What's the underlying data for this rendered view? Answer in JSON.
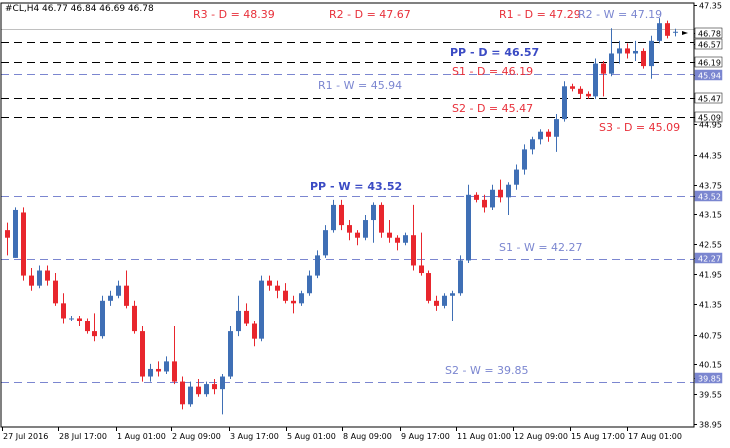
{
  "chart_data": {
    "type": "candlestick",
    "symbol_info": "#CL,H4  46.77 46.84 46.69 46.78",
    "y_axis": {
      "range": [
        38.95,
        47.35
      ],
      "ticks": [
        "47.35",
        "46.78",
        "46.57",
        "46.19",
        "45.94",
        "45.47",
        "45.09",
        "44.95",
        "44.35",
        "43.75",
        "43.52",
        "43.15",
        "42.55",
        "42.27",
        "41.95",
        "41.35",
        "40.75",
        "40.15",
        "39.85",
        "39.55",
        "38.95"
      ],
      "badges": [
        {
          "label": "46.78",
          "value": 46.78,
          "bg": "#ffffff",
          "fg": "#000000"
        },
        {
          "label": "46.57",
          "value": 46.57,
          "bg": "#ffffff",
          "fg": "#000000"
        },
        {
          "label": "46.19",
          "value": 46.19,
          "bg": "#ffffff",
          "fg": "#000000"
        },
        {
          "label": "45.94",
          "value": 45.94,
          "bg": "#7b86d0",
          "fg": "#ffffff"
        },
        {
          "label": "45.47",
          "value": 45.47,
          "bg": "#ffffff",
          "fg": "#000000"
        },
        {
          "label": "45.09",
          "value": 45.09,
          "bg": "#ffffff",
          "fg": "#000000"
        },
        {
          "label": "43.52",
          "value": 43.52,
          "bg": "#7b86d0",
          "fg": "#ffffff"
        },
        {
          "label": "42.27",
          "value": 42.27,
          "bg": "#7b86d0",
          "fg": "#ffffff"
        },
        {
          "label": "39.85",
          "value": 39.85,
          "bg": "#7b86d0",
          "fg": "#ffffff"
        }
      ]
    },
    "x_axis": {
      "tick_labels": [
        "27 Jul 2016",
        "28 Jul 17:00",
        "1 Aug 01:00",
        "2 Aug 09:00",
        "3 Aug 17:00",
        "5 Aug 01:00",
        "8 Aug 09:00",
        "9 Aug 17:00",
        "11 Aug 01:00",
        "12 Aug 09:00",
        "15 Aug 17:00",
        "17 Aug 01:00"
      ]
    },
    "levels": [
      {
        "name": "R3 - D = 48.39",
        "value": 48.39,
        "color": "#e8303a",
        "style": "label-only"
      },
      {
        "name": "R2 - D = 47.67",
        "value": 47.67,
        "color": "#e8303a",
        "style": "label-only"
      },
      {
        "name": "R1 - D = 47.29",
        "value": 47.29,
        "color": "#e8303a",
        "style": "label-only"
      },
      {
        "name": "R2 - W = 47.19",
        "value": 47.19,
        "color": "#7b86d0",
        "style": "label-only"
      },
      {
        "name": "PP - D = 46.57",
        "value": 46.57,
        "color": "#3b4bc4",
        "style": "dashed-black"
      },
      {
        "name": "S1 - D = 46.19",
        "value": 46.19,
        "color": "#e8303a",
        "style": "dashed-black"
      },
      {
        "name": "R1 - W = 45.94",
        "value": 45.94,
        "color": "#7b86d0",
        "style": "dashed-blue"
      },
      {
        "name": "S2 - D = 45.47",
        "value": 45.47,
        "color": "#e8303a",
        "style": "dashed-black"
      },
      {
        "name": "S3 - D = 45.09",
        "value": 45.09,
        "color": "#e8303a",
        "style": "dashed-black"
      },
      {
        "name": "PP - W = 43.52",
        "value": 43.52,
        "color": "#3b4bc4",
        "style": "dashed-blue"
      },
      {
        "name": "S1 - W = 42.27",
        "value": 42.27,
        "color": "#7b86d0",
        "style": "dashed-blue"
      },
      {
        "name": "S2 - W = 39.85",
        "value": 39.85,
        "color": "#7b86d0",
        "style": "dashed-blue"
      }
    ],
    "candles": [
      {
        "o": 42.85,
        "h": 43.0,
        "l": 42.35,
        "c": 42.7
      },
      {
        "o": 42.3,
        "h": 43.3,
        "l": 42.3,
        "c": 43.25
      },
      {
        "o": 43.2,
        "h": 43.3,
        "l": 41.85,
        "c": 41.95
      },
      {
        "o": 41.95,
        "h": 42.1,
        "l": 41.65,
        "c": 41.75
      },
      {
        "o": 41.75,
        "h": 42.15,
        "l": 41.7,
        "c": 42.05
      },
      {
        "o": 42.05,
        "h": 42.15,
        "l": 41.75,
        "c": 41.85
      },
      {
        "o": 41.85,
        "h": 42.0,
        "l": 41.35,
        "c": 41.4
      },
      {
        "o": 41.4,
        "h": 41.6,
        "l": 41.0,
        "c": 41.1
      },
      {
        "o": 41.1,
        "h": 41.15,
        "l": 41.05,
        "c": 41.1
      },
      {
        "o": 41.1,
        "h": 41.15,
        "l": 40.95,
        "c": 41.05
      },
      {
        "o": 41.05,
        "h": 41.1,
        "l": 40.8,
        "c": 40.85
      },
      {
        "o": 40.85,
        "h": 41.2,
        "l": 40.65,
        "c": 40.75
      },
      {
        "o": 40.75,
        "h": 41.55,
        "l": 40.7,
        "c": 41.45
      },
      {
        "o": 41.45,
        "h": 41.65,
        "l": 41.35,
        "c": 41.55
      },
      {
        "o": 41.55,
        "h": 41.85,
        "l": 41.5,
        "c": 41.75
      },
      {
        "o": 41.75,
        "h": 42.05,
        "l": 41.3,
        "c": 41.35
      },
      {
        "o": 41.35,
        "h": 41.45,
        "l": 40.8,
        "c": 40.85
      },
      {
        "o": 40.85,
        "h": 40.95,
        "l": 39.85,
        "c": 39.95
      },
      {
        "o": 39.95,
        "h": 40.2,
        "l": 39.85,
        "c": 40.1
      },
      {
        "o": 40.1,
        "h": 40.25,
        "l": 39.95,
        "c": 40.05
      },
      {
        "o": 40.05,
        "h": 40.35,
        "l": 40.0,
        "c": 40.25
      },
      {
        "o": 40.25,
        "h": 40.95,
        "l": 39.8,
        "c": 39.85
      },
      {
        "o": 39.85,
        "h": 39.95,
        "l": 39.3,
        "c": 39.4
      },
      {
        "o": 39.4,
        "h": 39.85,
        "l": 39.35,
        "c": 39.75
      },
      {
        "o": 39.75,
        "h": 39.9,
        "l": 39.55,
        "c": 39.6
      },
      {
        "o": 39.6,
        "h": 39.85,
        "l": 39.55,
        "c": 39.8
      },
      {
        "o": 39.8,
        "h": 39.9,
        "l": 39.6,
        "c": 39.7
      },
      {
        "o": 39.7,
        "h": 40.0,
        "l": 39.2,
        "c": 39.95
      },
      {
        "o": 39.95,
        "h": 40.95,
        "l": 39.9,
        "c": 40.85
      },
      {
        "o": 40.85,
        "h": 41.55,
        "l": 40.75,
        "c": 41.25
      },
      {
        "o": 41.25,
        "h": 41.4,
        "l": 40.95,
        "c": 41.0
      },
      {
        "o": 41.0,
        "h": 41.05,
        "l": 40.55,
        "c": 40.7
      },
      {
        "o": 40.7,
        "h": 41.95,
        "l": 40.65,
        "c": 41.85
      },
      {
        "o": 41.85,
        "h": 41.95,
        "l": 41.65,
        "c": 41.75
      },
      {
        "o": 41.75,
        "h": 41.85,
        "l": 41.5,
        "c": 41.65
      },
      {
        "o": 41.65,
        "h": 41.8,
        "l": 41.4,
        "c": 41.45
      },
      {
        "o": 41.45,
        "h": 41.55,
        "l": 41.2,
        "c": 41.4
      },
      {
        "o": 41.4,
        "h": 41.65,
        "l": 41.35,
        "c": 41.6
      },
      {
        "o": 41.6,
        "h": 42.05,
        "l": 41.55,
        "c": 41.95
      },
      {
        "o": 41.95,
        "h": 42.45,
        "l": 41.9,
        "c": 42.35
      },
      {
        "o": 42.35,
        "h": 42.95,
        "l": 42.3,
        "c": 42.85
      },
      {
        "o": 42.85,
        "h": 43.45,
        "l": 42.8,
        "c": 43.35
      },
      {
        "o": 43.35,
        "h": 43.45,
        "l": 42.85,
        "c": 42.95
      },
      {
        "o": 42.95,
        "h": 43.05,
        "l": 42.65,
        "c": 42.8
      },
      {
        "o": 42.8,
        "h": 42.85,
        "l": 42.55,
        "c": 42.7
      },
      {
        "o": 42.7,
        "h": 43.15,
        "l": 42.65,
        "c": 43.05
      },
      {
        "o": 43.05,
        "h": 43.4,
        "l": 42.6,
        "c": 43.35
      },
      {
        "o": 43.35,
        "h": 43.4,
        "l": 42.7,
        "c": 42.8
      },
      {
        "o": 42.8,
        "h": 43.05,
        "l": 42.6,
        "c": 42.7
      },
      {
        "o": 42.7,
        "h": 42.75,
        "l": 42.45,
        "c": 42.6
      },
      {
        "o": 42.6,
        "h": 42.8,
        "l": 42.55,
        "c": 42.75
      },
      {
        "o": 42.75,
        "h": 43.35,
        "l": 42.05,
        "c": 42.15
      },
      {
        "o": 42.15,
        "h": 42.8,
        "l": 41.95,
        "c": 42.0
      },
      {
        "o": 42.0,
        "h": 42.05,
        "l": 41.4,
        "c": 41.45
      },
      {
        "o": 41.45,
        "h": 41.55,
        "l": 41.25,
        "c": 41.35
      },
      {
        "o": 41.35,
        "h": 41.6,
        "l": 41.3,
        "c": 41.55
      },
      {
        "o": 41.55,
        "h": 41.65,
        "l": 41.05,
        "c": 41.6
      },
      {
        "o": 41.6,
        "h": 42.35,
        "l": 41.55,
        "c": 42.25
      },
      {
        "o": 42.25,
        "h": 43.75,
        "l": 42.2,
        "c": 43.55
      },
      {
        "o": 43.55,
        "h": 43.6,
        "l": 43.4,
        "c": 43.45
      },
      {
        "o": 43.45,
        "h": 43.55,
        "l": 43.2,
        "c": 43.3
      },
      {
        "o": 43.3,
        "h": 43.75,
        "l": 43.25,
        "c": 43.65
      },
      {
        "o": 43.65,
        "h": 43.85,
        "l": 43.4,
        "c": 43.5
      },
      {
        "o": 43.5,
        "h": 43.8,
        "l": 43.15,
        "c": 43.75
      },
      {
        "o": 43.75,
        "h": 44.15,
        "l": 43.65,
        "c": 44.05
      },
      {
        "o": 44.05,
        "h": 44.55,
        "l": 43.95,
        "c": 44.45
      },
      {
        "o": 44.45,
        "h": 44.7,
        "l": 44.35,
        "c": 44.65
      },
      {
        "o": 44.65,
        "h": 44.85,
        "l": 44.55,
        "c": 44.8
      },
      {
        "o": 44.8,
        "h": 44.85,
        "l": 44.6,
        "c": 44.7
      },
      {
        "o": 44.7,
        "h": 45.15,
        "l": 44.4,
        "c": 45.05
      },
      {
        "o": 45.05,
        "h": 45.8,
        "l": 45.0,
        "c": 45.7
      },
      {
        "o": 45.7,
        "h": 45.75,
        "l": 45.6,
        "c": 45.65
      },
      {
        "o": 45.65,
        "h": 45.7,
        "l": 45.45,
        "c": 45.55
      },
      {
        "o": 45.55,
        "h": 45.6,
        "l": 45.45,
        "c": 45.5
      },
      {
        "o": 45.5,
        "h": 46.25,
        "l": 45.45,
        "c": 46.15
      },
      {
        "o": 46.15,
        "h": 46.2,
        "l": 45.5,
        "c": 45.95
      },
      {
        "o": 45.95,
        "h": 46.85,
        "l": 45.9,
        "c": 46.35
      },
      {
        "o": 46.35,
        "h": 46.6,
        "l": 46.15,
        "c": 46.45
      },
      {
        "o": 46.45,
        "h": 46.55,
        "l": 46.25,
        "c": 46.35
      },
      {
        "o": 46.35,
        "h": 46.6,
        "l": 46.2,
        "c": 46.4
      },
      {
        "o": 46.4,
        "h": 46.45,
        "l": 46.05,
        "c": 46.1
      },
      {
        "o": 46.1,
        "h": 46.7,
        "l": 45.85,
        "c": 46.6
      },
      {
        "o": 46.6,
        "h": 47.05,
        "l": 46.55,
        "c": 46.95
      },
      {
        "o": 46.95,
        "h": 47.0,
        "l": 46.65,
        "c": 46.7
      },
      {
        "o": 46.77,
        "h": 46.84,
        "l": 46.69,
        "c": 46.78
      }
    ],
    "colors": {
      "up": "#3f6fb5",
      "down": "#e8262d",
      "grid": "#000000",
      "weekly_line": "#7b86d0",
      "daily_line": "#000000"
    }
  }
}
